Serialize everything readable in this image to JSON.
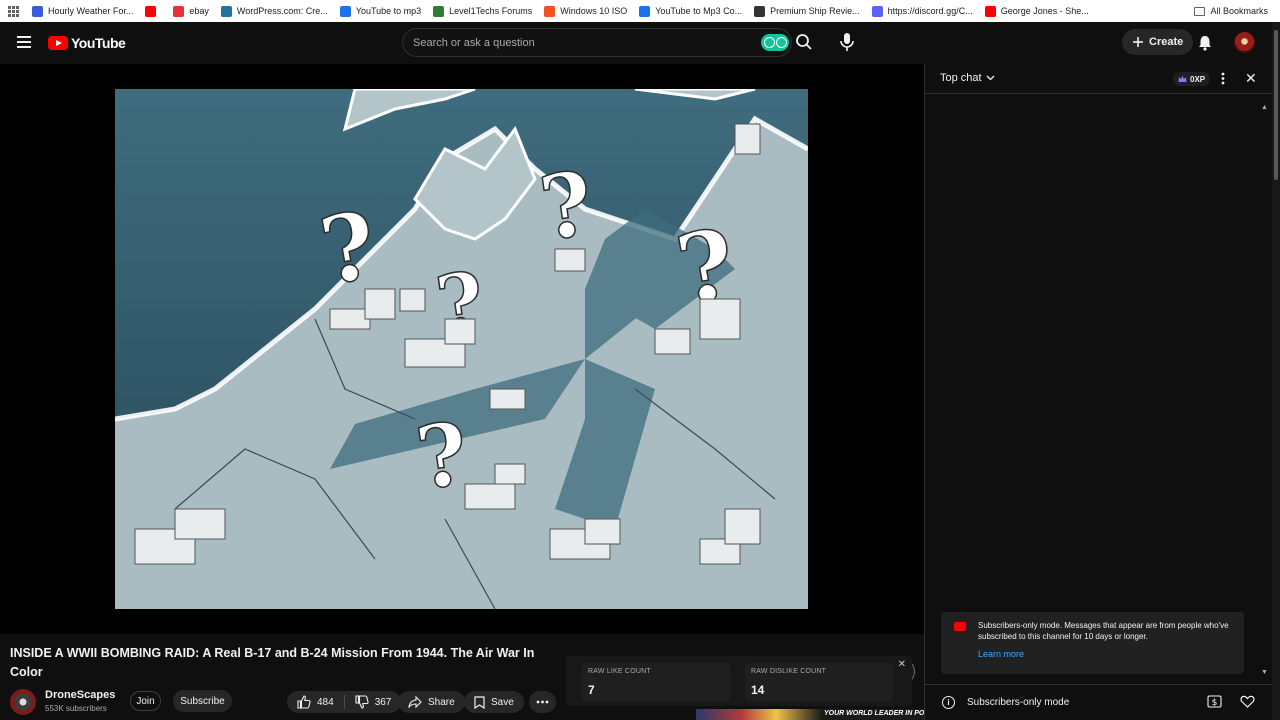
{
  "bookmarks": [
    {
      "label": "Hourly Weather For...",
      "color": "#3b5bdb"
    },
    {
      "label": "",
      "color": "#ff0000"
    },
    {
      "label": "ebay",
      "color": "#e53238"
    },
    {
      "label": "WordPress.com: Cre...",
      "color": "#21759b"
    },
    {
      "label": "YouTube to mp3",
      "color": "#1a73e8"
    },
    {
      "label": "Level1Techs Forums",
      "color": "#2e7d32"
    },
    {
      "label": "Windows 10 ISO",
      "color": "#f25022"
    },
    {
      "label": "YouTube to Mp3 Co...",
      "color": "#1a73e8"
    },
    {
      "label": "Premium Ship Revie...",
      "color": "#333333"
    },
    {
      "label": "https://discord.gg/C...",
      "color": "#5865f2"
    },
    {
      "label": "George Jones - She...",
      "color": "#ff0000"
    }
  ],
  "bookmarks_all": "All Bookmarks",
  "masthead": {
    "logo": "YouTube",
    "search_placeholder": "Search or ask a question",
    "create_label": "Create"
  },
  "video": {
    "title": "INSIDE A WWII BOMBING RAID: A Real B-17 and B-24 Mission From 1944. The Air War In Color",
    "channel": "DroneScapes",
    "subscribers": "553K subscribers",
    "join_label": "Join",
    "subscribe_label": "Subscribe",
    "likes": "484",
    "dislikes": "367",
    "share_label": "Share",
    "save_label": "Save"
  },
  "raw_counts": {
    "like_label": "RAW LIKE COUNT",
    "like_value": "7",
    "dislike_label": "RAW DISLIKE COUNT",
    "dislike_value": "14"
  },
  "banner_text": "YOUR WORLD LEADER IN POLKA MUSIC ENTERTAINMENT",
  "chat": {
    "header": "Top chat",
    "xp": "0XP",
    "notice": "Subscribers-only mode. Messages that appear are from people who've subscribed to this channel for 10 days or longer.",
    "learn_more": "Learn more",
    "footer": "Subscribers-only mode"
  },
  "colors": {
    "accent_red": "#ff0000",
    "link_blue": "#3ea6ff",
    "background": "#0f0f0f"
  }
}
